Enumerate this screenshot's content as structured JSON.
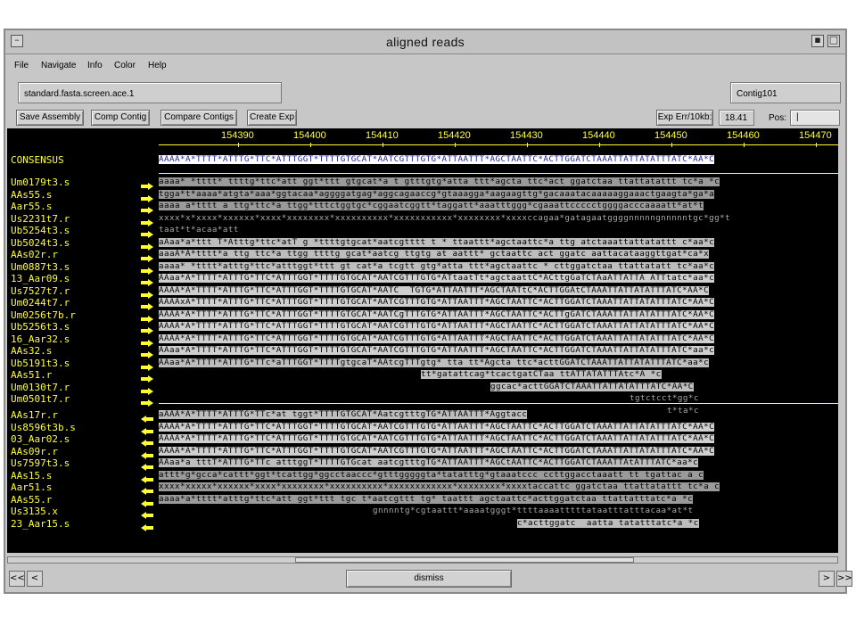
{
  "window": {
    "title": "aligned reads"
  },
  "menu": [
    "File",
    "Navigate",
    "Info",
    "Color",
    "Help"
  ],
  "file_field": "standard.fasta.screen.ace.1",
  "contig_field": "Contig101",
  "toolbar": {
    "save": "Save Assembly",
    "comp": "Comp Contig",
    "compare": "Compare Contigs",
    "create": "Create Exp",
    "experr": "Exp Err/10kb:",
    "experr_val": "18.41",
    "pos": "Pos:",
    "pos_val": "|"
  },
  "ruler": [
    "154390",
    "154400",
    "154410",
    "154420",
    "154430",
    "154440",
    "154450",
    "154460",
    "154470"
  ],
  "consensus": {
    "name": "CONSENSUS",
    "seq": "AAAA*A*TTTT*ATTTG*TTC*ATTTGGT*TTTTGTGCAT*AATCGTTTGTG*ATTAATTT*AGCTAATTC*ACTTGGATCTAAATTATTATATTTATC*AA*C"
  },
  "forward_reads": [
    {
      "name": "Um0179t3.s",
      "seq": "aaaa* *tttt* ttttg*ttc*att ggt*ttt gtgcat*a t gtttgtg*atta ttt*agcta ttc*act ggatctaa ttattatattt tc*a *c",
      "style": "grey"
    },
    {
      "name": "AAs55.s",
      "seq": "tgga*t*aaaa*atgta*aaa*ggtacaa*aggggatgag*aggcagaaccg*gtaaagga*aagaagttg*gacaaatacaaaaaggaaactgaagta*ga*a",
      "style": "grey"
    },
    {
      "name": "Aar55.s",
      "seq": "aaaa a*tttt a ttg*ttc*a ttgg*tttctggtgc*cggaatcggtt*taggatt*aaatttggg*cgaaattccccctggggacccaaaatt*at*t",
      "style": "grey"
    },
    {
      "name": "Us2231t7.r",
      "seq": "xxxx*x*xxxx*xxxxxx*xxxx*xxxxxxxx*xxxxxxxxxx*xxxxxxxxxxx*xxxxxxxx*xxxxccagaa*gatagaatggggnnnnngnnnnntgc*gg*t",
      "style": "dark"
    },
    {
      "name": "Ub5254t3.s",
      "seq": "taat*t*acaa*att",
      "style": "dark"
    },
    {
      "name": "Ub5024t3.s",
      "seq": "aAaa*a*ttt T*Atttg*ttc*atT g *ttttgtgcat*aatcgtttt t * ttaattt*agctaattc*a ttg atctaaattattatattt c*aa*c",
      "style": "mix"
    },
    {
      "name": "AAs02r.r",
      "seq": "aaaA*A*tttt*a ttg ttc*a ttgg ttttg gcat*aatcg ttgtg at aattt* gctaattc act ggatc aattacataaggttgat*ca*x",
      "style": "mix"
    },
    {
      "name": "Um0887t3.s",
      "seq": "aaaa* *tttt*atttg*ttc*atttggt*ttt gt cat*a tcgtt gtg*atta ttt*agctaattc * cttggatctaa ttattatatt tc*aa*c",
      "style": "mix"
    },
    {
      "name": "13_Aar09.s",
      "seq": "AAaa*A*TTTT*ATTTG*TTC*ATTTGGT*TTTTGTGCAT*AATCGTTTGTG*ATtaatTt*agctaattC*ACttgGaTCTAaATTATTA ATTtatc*aa*c",
      "style": "lite"
    },
    {
      "name": "Us7527t7.r",
      "seq": "AAAA*A*TTTT*ATTTG*TTC*ATTTGGT*TTTTGTGCAT*AATC  TGTG*ATTAATTT*AGCTAATtC*ACTTGGAtCTAAATTATTATATTTATC*AA*C",
      "style": "lite"
    },
    {
      "name": "Um0244t7.r",
      "seq": "AAAAxA*TTTT*ATTTG*TTC*ATTTGGT*TTTTGTGCAT*AATCGTTTGTG*ATTAATTT*AGCTAATTC*ACTTGGATCTAAATTATTATATTTATC*AA*C",
      "style": "lite"
    },
    {
      "name": "Um0256t7b.r",
      "seq": "AAAA*A*TTTT*ATTTG*TTC*ATTTGGT*TTTTGTGCAT*AATCgTTTGTG*ATTAATTT*AGCTAATTC*ACTTgGATCTAAATTATTATATTTATC*AA*C",
      "style": "lite"
    },
    {
      "name": "Ub5256t3.s",
      "seq": "AAAA*A*TTTT*ATTTG*TTC*ATTTGGT*TTTTGTGCAT*AATCGTTTGTG*ATTAATTT*AGCTAATTC*ACTTGGATCTAAATTATTATATTTATC*AA*C",
      "style": "lite"
    },
    {
      "name": "16_Aar32.s",
      "seq": "AAAA*A*TTTT*ATTTG*TTC*ATTTGGT*TTTTGTGCAT*AATCGTTTGTG*ATTAATTT*AGCTAATTC*ACTTGGATCTAAATTATTATATTTATC*AA*C",
      "style": "lite"
    },
    {
      "name": "AAs32.s",
      "seq": "AAaa*A*TTTT*ATTTG*TTC*ATTTGGT*TTTTGTGCAT*AATCGTTTGTG*ATTAATTT*AGCTAATTC*ACTTGGATCTAAATTATTATATTTATC*aa*c",
      "style": "lite"
    },
    {
      "name": "Ub5191t3.s",
      "seq": "AAaa*A*TTTT*ATTTG*TTc*aTTTGGT*TTTTgtgcaT*AAtcgTTTgtg* tta tt*Agcta ttc*acttGGATCTAAATTATTATATTTATC*aa*c",
      "style": "mix"
    },
    {
      "name": "AAs51.r",
      "seq": "tt*gatattcag*tcactgatCTaa ttATTATATTTAtc*A *c",
      "style": "mix",
      "offset": 49
    },
    {
      "name": "Um0130t7.r",
      "seq": "ggcac*acttGGATCTAAATTATTATATTTATC*AA*C",
      "style": "mix",
      "offset": 62
    },
    {
      "name": "Um0501t7.r",
      "seq": "tgtctcct*gg*c",
      "style": "dark",
      "offset": 88
    },
    {
      "name": "",
      "seq": "t*ta*c",
      "style": "dark",
      "offset": 95
    }
  ],
  "reverse_reads": [
    {
      "name": "AAs17r.r",
      "seq": "aAAA*A*TTTT*ATTTG*TTc*at tggt*TTTTGTGCAT*AatcgtttgTG*ATTAATTT*Aggtacc",
      "style": "mix"
    },
    {
      "name": "Us8596t3b.s",
      "seq": "AAAA*A*TTTT*ATTTG*TTC*ATTTGGT*TTTTGTGCAT*AATCGTTTGTG*ATTAATTT*AGCTAATTC*ACTTGGATCTAAATTATTATATTTATC*AA*C",
      "style": "lite"
    },
    {
      "name": "03_Aar02.s",
      "seq": "AAAA*A*TTTT*ATTTG*TTC*ATTTGGT*TTTTGTGCAT*AATCGTTTGTG*ATTAATTT*AGCTAATTC*ACTTGGATCTAAATTATTATATTTATC*AA*C",
      "style": "lite"
    },
    {
      "name": "AAs09r.r",
      "seq": "AAAA*A*TTTT*ATTTG*TTC*ATTTGGT*TTTTGTGCAT*AATCGTTTGTG*ATTAATTT*AGCTAATTC*ACTTGGATCTAAATTATTATATTTATC*AA*C",
      "style": "lite"
    },
    {
      "name": "Us7597t3.s",
      "seq": "AAaa*a tttT*ATTTG*TTc atttggT*TTTTGTGcat aatcgtttgTG*ATTAATTT*AGCtAATTC*ACTTGGATCTAAATTAtATTTATC*aa*c",
      "style": "mix"
    },
    {
      "name": "AAs15.s",
      "seq": "attt*g*gcca*cattt*ggt*tcattgg*ggcctaaccc*gtttgggggta*tatatttg*gtaaatccc ccttggacctaaatt tt tgattac a c",
      "style": "grey"
    },
    {
      "name": "Aar51.s",
      "seq": "xxxx*xxxxx*xxxxxx*xxxx*xxxxxxxx*xxxxxxxxxx*xxxxxxxxxxxx*xxxxxxxx*xxxxtaccattc ggatctaa ttattatattt tc*a c",
      "style": "grey"
    },
    {
      "name": "AAs55.r",
      "seq": "aaaa*a*tttt*atttg*ttc*att ggt*ttt tgc t*aatcgttt tg* taattt agctaattc*acttggatctaa ttattatttatc*a *c",
      "style": "grey"
    },
    {
      "name": "Us3135.x",
      "seq": "gnnnntg*cgtaattt*aaaatgggt*ttttaaaatttttataatttatttacaa*at*t",
      "style": "dark",
      "offset": 40
    },
    {
      "name": "23_Aar15.s",
      "seq": "c*acttggatc  aatta tatatttatc*a *c",
      "style": "mix",
      "offset": 67
    }
  ],
  "bottom": {
    "dismiss": "dismiss"
  },
  "colors": {
    "names": "#ffff33",
    "background": "#000000",
    "consensus_text": "#1c1ca0"
  }
}
